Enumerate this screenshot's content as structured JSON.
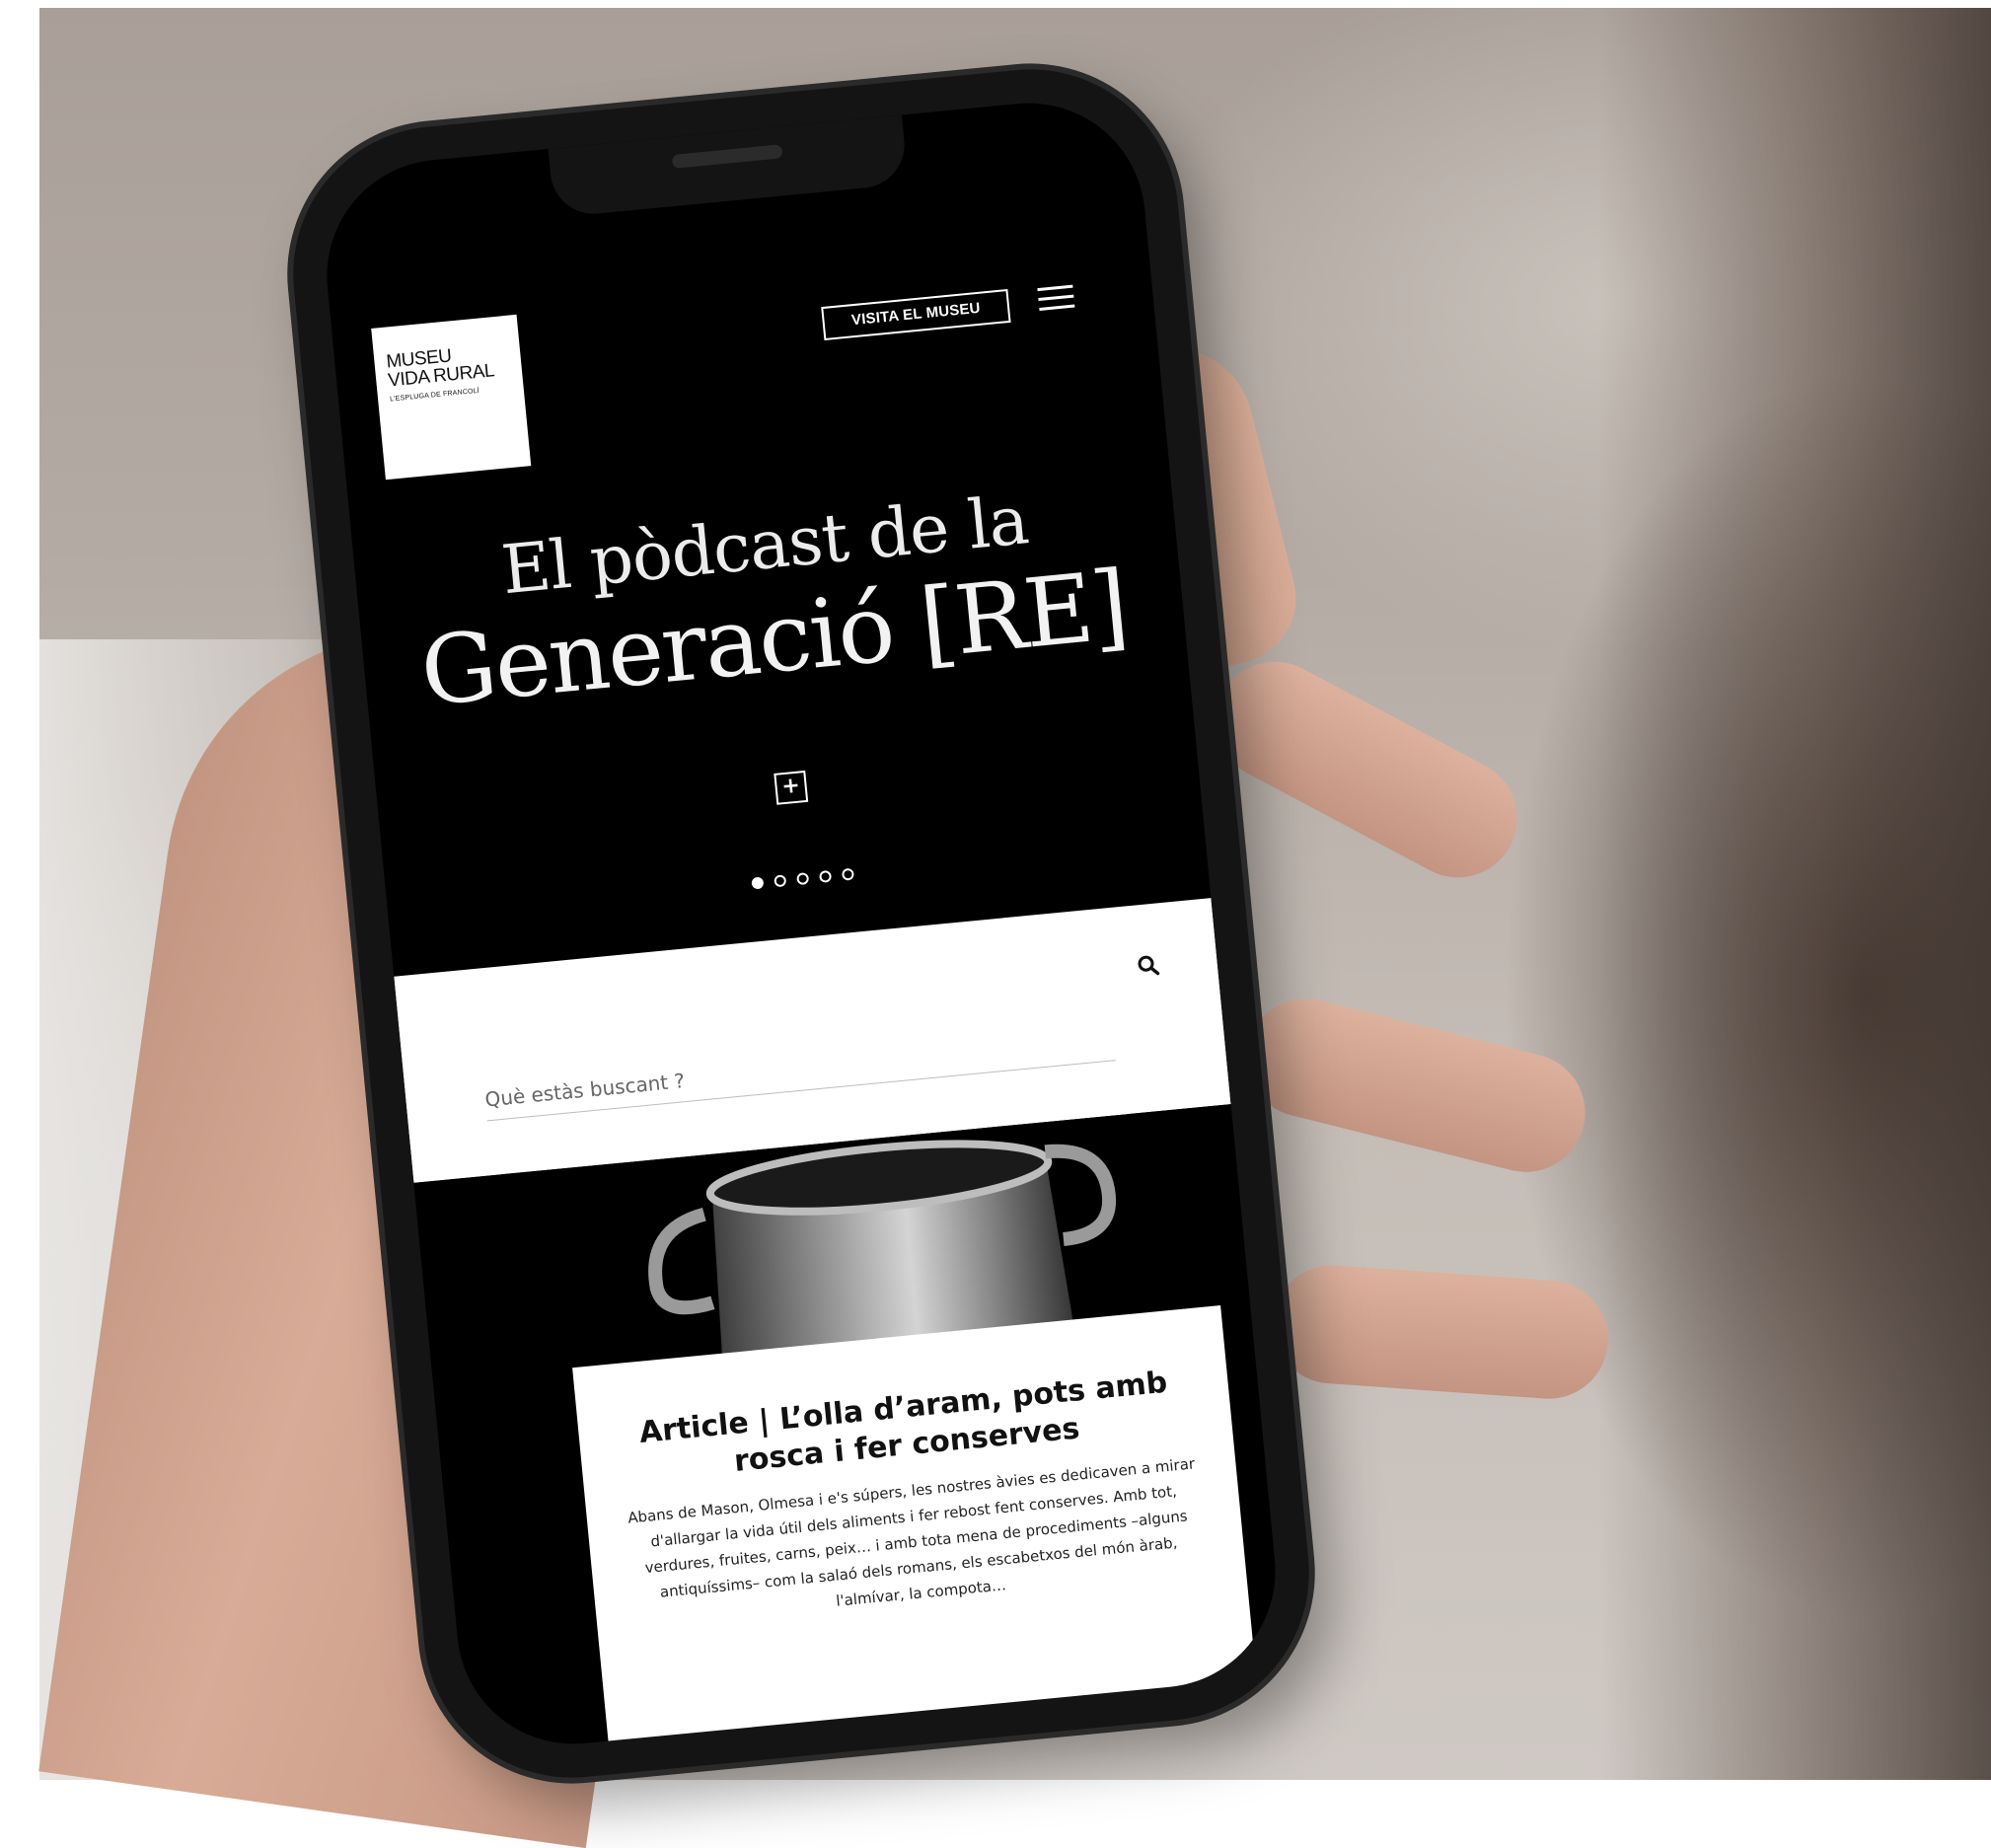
{
  "logo": {
    "line1": "MUSEU",
    "line2": "VIDA RURAL",
    "line3": "L'ESPLUGA DE FRANCOLÍ"
  },
  "header": {
    "visit_button": "VISITA EL MUSEU",
    "menu_icon": "hamburger-menu-icon"
  },
  "hero": {
    "line1": "El pòdcast de la",
    "line2": "Generació [RE]",
    "expand_icon": "plus-icon",
    "slides_total": 5,
    "slide_active": 1
  },
  "search": {
    "placeholder": "Què estàs buscant ?",
    "icon": "search-icon"
  },
  "article": {
    "title": "Article | L’olla d’aram, pots amb rosca i fer conserves",
    "body": "Abans de Mason, Olmesa i e's súpers, les nostres àvies es dedicaven a mirar d'allargar la vida útil dels aliments i fer rebost fent conserves. Amb tot, verdures, fruites, carns, peix… i amb tota mena de procediments –alguns antiquíssims– com la salaó dels romans, els escabetxos del món àrab, l'almívar, la compota…"
  },
  "colors": {
    "screen_background": "#000000",
    "text_on_dark": "#ffffff",
    "band_background": "#ffffff"
  }
}
